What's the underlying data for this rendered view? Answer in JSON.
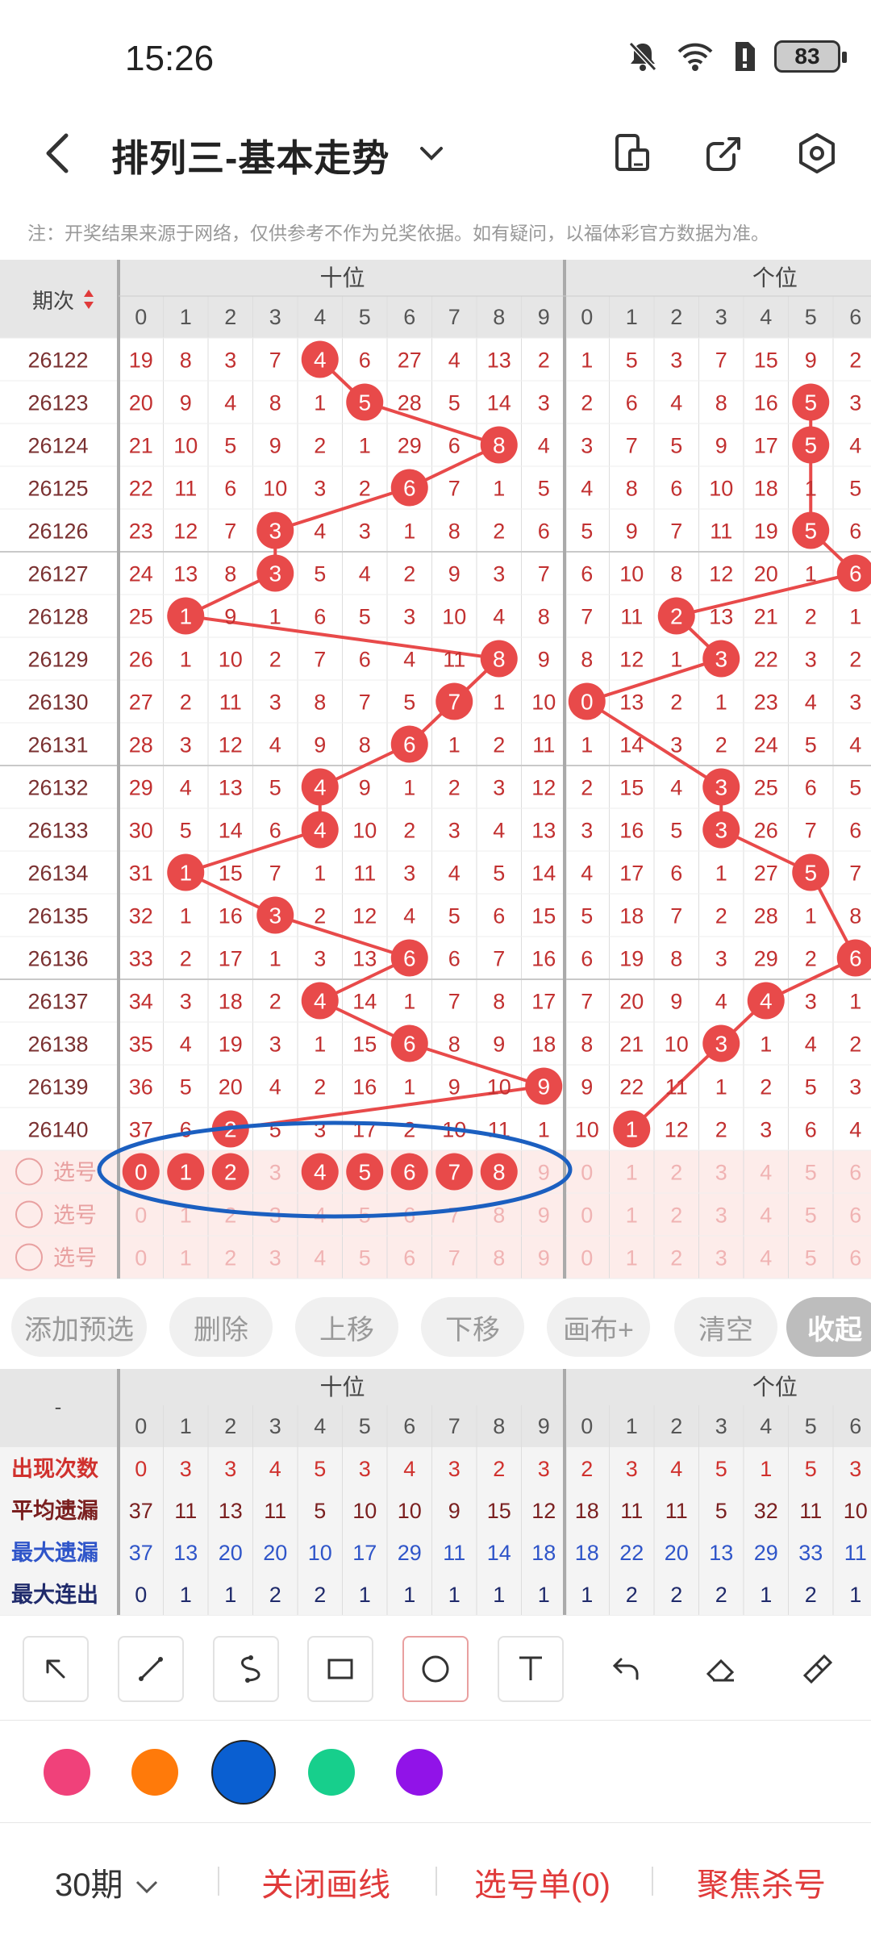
{
  "status_bar": {
    "time": "15:26",
    "battery": "83"
  },
  "header": {
    "title": "排列三-基本走势"
  },
  "note": "注：开奖结果来源于网络，仅供参考不作为兑奖依据。如有疑问，以福体彩官方数据为准。",
  "table": {
    "period_header": "期次",
    "group_tens": "十位",
    "group_units": "个位",
    "digit_headers": [
      "0",
      "1",
      "2",
      "3",
      "4",
      "5",
      "6",
      "7",
      "8",
      "9"
    ],
    "units_visible_digits": [
      "0",
      "1",
      "2",
      "3",
      "4",
      "5",
      "6"
    ],
    "rows": [
      {
        "period": "26122",
        "tens": [
          "19",
          "8",
          "3",
          "7",
          "4",
          "6",
          "27",
          "4",
          "13",
          "2"
        ],
        "tens_hit": 4,
        "units": [
          "1",
          "5",
          "3",
          "7",
          "15",
          "9",
          "2"
        ],
        "units_hit": null
      },
      {
        "period": "26123",
        "tens": [
          "20",
          "9",
          "4",
          "8",
          "1",
          "5",
          "28",
          "5",
          "14",
          "3"
        ],
        "tens_hit": 5,
        "units": [
          "2",
          "6",
          "4",
          "8",
          "16",
          "5",
          "3"
        ],
        "units_hit": 5
      },
      {
        "period": "26124",
        "tens": [
          "21",
          "10",
          "5",
          "9",
          "2",
          "1",
          "29",
          "6",
          "8",
          "4"
        ],
        "tens_hit": 8,
        "units": [
          "3",
          "7",
          "5",
          "9",
          "17",
          "5",
          "4"
        ],
        "units_hit": 5
      },
      {
        "period": "26125",
        "tens": [
          "22",
          "11",
          "6",
          "10",
          "3",
          "2",
          "6",
          "7",
          "1",
          "5"
        ],
        "tens_hit": 6,
        "units": [
          "4",
          "8",
          "6",
          "10",
          "18",
          "1",
          "5"
        ],
        "units_hit": null
      },
      {
        "period": "26126",
        "tens": [
          "23",
          "12",
          "7",
          "3",
          "4",
          "3",
          "1",
          "8",
          "2",
          "6"
        ],
        "tens_hit": 3,
        "units": [
          "5",
          "9",
          "7",
          "11",
          "19",
          "5",
          "6"
        ],
        "units_hit": 5
      },
      {
        "period": "26127",
        "tens": [
          "24",
          "13",
          "8",
          "3",
          "5",
          "4",
          "2",
          "9",
          "3",
          "7"
        ],
        "tens_hit": 3,
        "units": [
          "6",
          "10",
          "8",
          "12",
          "20",
          "1",
          "6"
        ],
        "units_hit": 6
      },
      {
        "period": "26128",
        "tens": [
          "25",
          "1",
          "9",
          "1",
          "6",
          "5",
          "3",
          "10",
          "4",
          "8"
        ],
        "tens_hit": 1,
        "units": [
          "7",
          "11",
          "2",
          "13",
          "21",
          "2",
          "1"
        ],
        "units_hit": 2
      },
      {
        "period": "26129",
        "tens": [
          "26",
          "1",
          "10",
          "2",
          "7",
          "6",
          "4",
          "11",
          "8",
          "9"
        ],
        "tens_hit": 8,
        "units": [
          "8",
          "12",
          "1",
          "3",
          "22",
          "3",
          "2"
        ],
        "units_hit": 3
      },
      {
        "period": "26130",
        "tens": [
          "27",
          "2",
          "11",
          "3",
          "8",
          "7",
          "5",
          "7",
          "1",
          "10"
        ],
        "tens_hit": 7,
        "units": [
          "0",
          "13",
          "2",
          "1",
          "23",
          "4",
          "3"
        ],
        "units_hit": 0
      },
      {
        "period": "26131",
        "tens": [
          "28",
          "3",
          "12",
          "4",
          "9",
          "8",
          "6",
          "1",
          "2",
          "11"
        ],
        "tens_hit": 6,
        "units": [
          "1",
          "14",
          "3",
          "2",
          "24",
          "5",
          "4"
        ],
        "units_hit": null
      },
      {
        "period": "26132",
        "tens": [
          "29",
          "4",
          "13",
          "5",
          "4",
          "9",
          "1",
          "2",
          "3",
          "12"
        ],
        "tens_hit": 4,
        "units": [
          "2",
          "15",
          "4",
          "3",
          "25",
          "6",
          "5"
        ],
        "units_hit": 3
      },
      {
        "period": "26133",
        "tens": [
          "30",
          "5",
          "14",
          "6",
          "4",
          "10",
          "2",
          "3",
          "4",
          "13"
        ],
        "tens_hit": 4,
        "units": [
          "3",
          "16",
          "5",
          "3",
          "26",
          "7",
          "6"
        ],
        "units_hit": 3
      },
      {
        "period": "26134",
        "tens": [
          "31",
          "1",
          "15",
          "7",
          "1",
          "11",
          "3",
          "4",
          "5",
          "14"
        ],
        "tens_hit": 1,
        "units": [
          "4",
          "17",
          "6",
          "1",
          "27",
          "5",
          "7"
        ],
        "units_hit": 5
      },
      {
        "period": "26135",
        "tens": [
          "32",
          "1",
          "16",
          "3",
          "2",
          "12",
          "4",
          "5",
          "6",
          "15"
        ],
        "tens_hit": 3,
        "units": [
          "5",
          "18",
          "7",
          "2",
          "28",
          "1",
          "8"
        ],
        "units_hit": null
      },
      {
        "period": "26136",
        "tens": [
          "33",
          "2",
          "17",
          "1",
          "3",
          "13",
          "6",
          "6",
          "7",
          "16"
        ],
        "tens_hit": 6,
        "units": [
          "6",
          "19",
          "8",
          "3",
          "29",
          "2",
          "6"
        ],
        "units_hit": 6
      },
      {
        "period": "26137",
        "tens": [
          "34",
          "3",
          "18",
          "2",
          "4",
          "14",
          "1",
          "7",
          "8",
          "17"
        ],
        "tens_hit": 4,
        "units": [
          "7",
          "20",
          "9",
          "4",
          "4",
          "3",
          "1"
        ],
        "units_hit": 4
      },
      {
        "period": "26138",
        "tens": [
          "35",
          "4",
          "19",
          "3",
          "1",
          "15",
          "6",
          "8",
          "9",
          "18"
        ],
        "tens_hit": 6,
        "units": [
          "8",
          "21",
          "10",
          "3",
          "1",
          "4",
          "2"
        ],
        "units_hit": 3
      },
      {
        "period": "26139",
        "tens": [
          "36",
          "5",
          "20",
          "4",
          "2",
          "16",
          "1",
          "9",
          "10",
          "9"
        ],
        "tens_hit": 9,
        "units": [
          "9",
          "22",
          "11",
          "1",
          "2",
          "5",
          "3"
        ],
        "units_hit": null
      },
      {
        "period": "26140",
        "tens": [
          "37",
          "6",
          "2",
          "5",
          "3",
          "17",
          "2",
          "10",
          "11",
          "1"
        ],
        "tens_hit": 2,
        "units": [
          "10",
          "1",
          "12",
          "2",
          "3",
          "6",
          "4"
        ],
        "units_hit": 1
      }
    ],
    "select_label": "选号",
    "select_rows": [
      {
        "selected_tens": [
          0,
          1,
          2,
          4,
          5,
          6,
          7,
          8
        ]
      },
      {
        "selected_tens": []
      },
      {
        "selected_tens": []
      }
    ]
  },
  "actions": [
    "添加预选",
    "删除",
    "上移",
    "下移",
    "画布+",
    "清空",
    "收起"
  ],
  "stats": {
    "corner": "-",
    "rows": [
      {
        "label": "出现次数",
        "color": "#d0312d",
        "tens": [
          "0",
          "3",
          "3",
          "4",
          "5",
          "3",
          "4",
          "3",
          "2",
          "3"
        ],
        "units": [
          "2",
          "3",
          "4",
          "5",
          "1",
          "5",
          "3"
        ]
      },
      {
        "label": "平均遗漏",
        "color": "#7a1f1f",
        "tens": [
          "37",
          "11",
          "13",
          "11",
          "5",
          "10",
          "10",
          "9",
          "15",
          "12"
        ],
        "units": [
          "18",
          "11",
          "11",
          "5",
          "32",
          "11",
          "10"
        ]
      },
      {
        "label": "最大遗漏",
        "color": "#2f55c9",
        "tens": [
          "37",
          "13",
          "20",
          "20",
          "10",
          "17",
          "29",
          "11",
          "14",
          "18"
        ],
        "units": [
          "18",
          "22",
          "20",
          "13",
          "29",
          "33",
          "11"
        ]
      },
      {
        "label": "最大连出",
        "color": "#1f2a6b",
        "tens": [
          "0",
          "1",
          "1",
          "2",
          "2",
          "1",
          "1",
          "1",
          "1",
          "1"
        ],
        "units": [
          "1",
          "2",
          "2",
          "2",
          "1",
          "2",
          "1"
        ]
      }
    ]
  },
  "tools": [
    "arrow-tool-icon",
    "line-tool-icon",
    "curve-tool-icon",
    "rectangle-tool-icon",
    "circle-tool-icon",
    "text-tool-icon",
    "undo-icon",
    "eraser-icon",
    "clear-brush-icon"
  ],
  "colors": [
    "#f0417a",
    "#ff7a0a",
    "#0a5fd1",
    "#17cf8c",
    "#9113e8"
  ],
  "selected_color": "#0a5fd1",
  "bottom": {
    "period_select": "30期",
    "close_line": "关闭画线",
    "selection_list": "选号单(0)",
    "focus_kill": "聚焦杀号"
  }
}
